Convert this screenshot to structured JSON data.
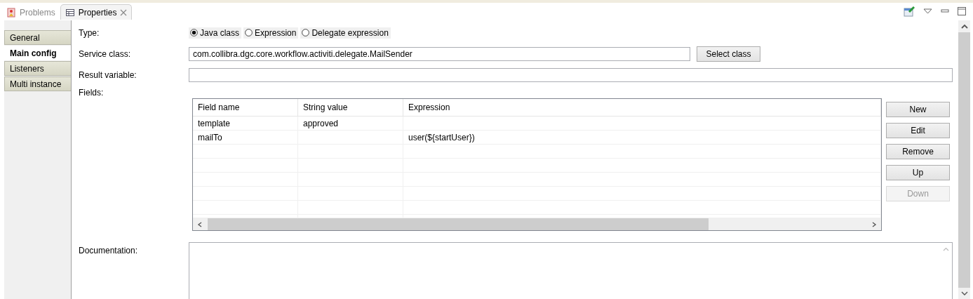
{
  "tabs": [
    {
      "label": "Problems",
      "selected": false,
      "closable": false
    },
    {
      "label": "Properties",
      "selected": true,
      "closable": true
    }
  ],
  "sidebar": {
    "items": [
      {
        "label": "General",
        "selected": false
      },
      {
        "label": "Main config",
        "selected": true
      },
      {
        "label": "Listeners",
        "selected": false
      },
      {
        "label": "Multi instance",
        "selected": false
      }
    ]
  },
  "form": {
    "type": {
      "label": "Type:",
      "options": [
        {
          "label": "Java class",
          "selected": true
        },
        {
          "label": "Expression",
          "selected": false
        },
        {
          "label": "Delegate expression",
          "selected": false
        }
      ]
    },
    "service_class": {
      "label": "Service class:",
      "value": "com.collibra.dgc.core.workflow.activiti.delegate.MailSender",
      "button": "Select class"
    },
    "result_variable": {
      "label": "Result variable:"
    },
    "fields": {
      "label": "Fields:",
      "table": {
        "columns": [
          "Field name",
          "String value",
          "Expression"
        ],
        "rows": [
          {
            "field_name": "template",
            "string_value": "approved"
          },
          {
            "field_name": "mailTo",
            "expression": "user(${startUser})"
          }
        ]
      },
      "buttons": [
        {
          "label": "New",
          "disabled": false
        },
        {
          "label": "Edit",
          "disabled": false
        },
        {
          "label": "Remove",
          "disabled": false
        },
        {
          "label": "Up",
          "disabled": false
        },
        {
          "label": "Down",
          "disabled": true
        }
      ]
    },
    "documentation": {
      "label": "Documentation:"
    }
  }
}
